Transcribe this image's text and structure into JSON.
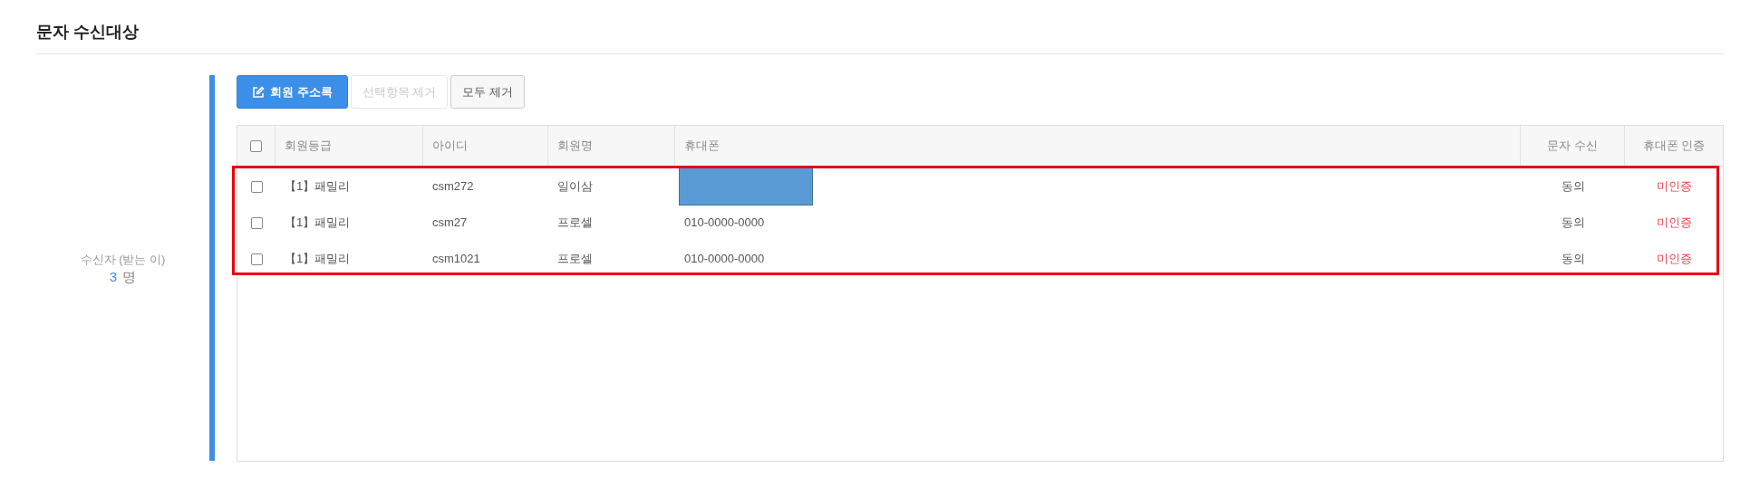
{
  "section_title": "문자 수신대상",
  "recipients": {
    "label": "수신자 (받는 이)",
    "count": "3",
    "unit": "명"
  },
  "buttons": [
    {
      "label": "회원 주소록",
      "kind": "primary",
      "disabled": false
    },
    {
      "label": "선택항목 제거",
      "kind": "default",
      "disabled": true
    },
    {
      "label": "모두 제거",
      "kind": "default",
      "disabled": false
    }
  ],
  "table": {
    "select_all_checked": false,
    "columns": [
      "회원등급",
      "아이디",
      "회원명",
      "휴대폰",
      "문자 수신",
      "휴대폰 인증"
    ],
    "rows": [
      {
        "checked": false,
        "grade": "【1】패밀리",
        "id": "csm272",
        "name": "일이삼",
        "phone_redacted": true,
        "sms": "동의",
        "auth": "미인증"
      },
      {
        "checked": false,
        "grade": "【1】패밀리",
        "id": "csm27",
        "name": "프로셀",
        "phone": "010-0000-0000",
        "phone_redacted": false,
        "sms": "동의",
        "auth": "미인증"
      },
      {
        "checked": false,
        "grade": "【1】패밀리",
        "id": "csm1021",
        "name": "프로셀",
        "phone": "010-0000-0000",
        "phone_redacted": false,
        "sms": "동의",
        "auth": "미인증"
      }
    ],
    "highlighted": true
  }
}
